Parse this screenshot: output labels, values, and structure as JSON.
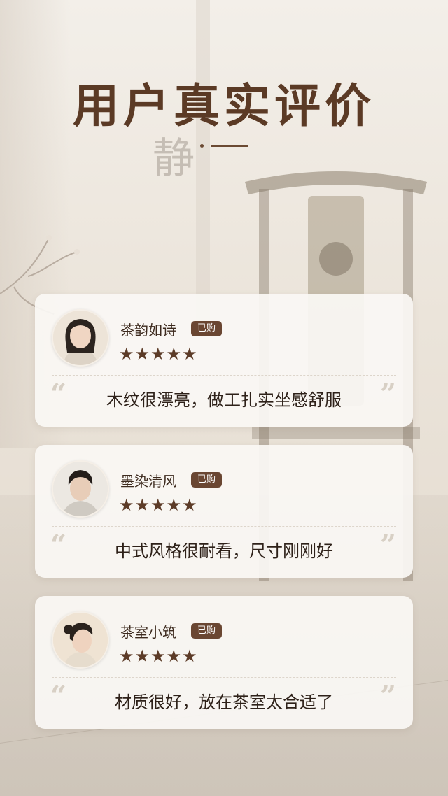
{
  "page": {
    "title": "用户真实评价",
    "background_calligraphy": "静"
  },
  "reviews": [
    {
      "name": "茶韵如诗",
      "badge": "已购",
      "rating": 5,
      "stars": "★★★★★",
      "quote_open": "“",
      "quote_close": "”",
      "text": "木纹很漂亮，做工扎实坐感舒服"
    },
    {
      "name": "墨染清风",
      "badge": "已购",
      "rating": 5,
      "stars": "★★★★★",
      "quote_open": "“",
      "quote_close": "”",
      "text": "中式风格很耐看，尺寸刚刚好"
    },
    {
      "name": "茶室小筑",
      "badge": "已购",
      "rating": 5,
      "stars": "★★★★★",
      "quote_open": "“",
      "quote_close": "”",
      "text": "材质很好，放在茶室太合适了"
    }
  ],
  "colors": {
    "accent": "#5b3a25",
    "badge_bg": "#6a4632",
    "star": "#5c3b27",
    "card_bg": "#faf8f4"
  }
}
